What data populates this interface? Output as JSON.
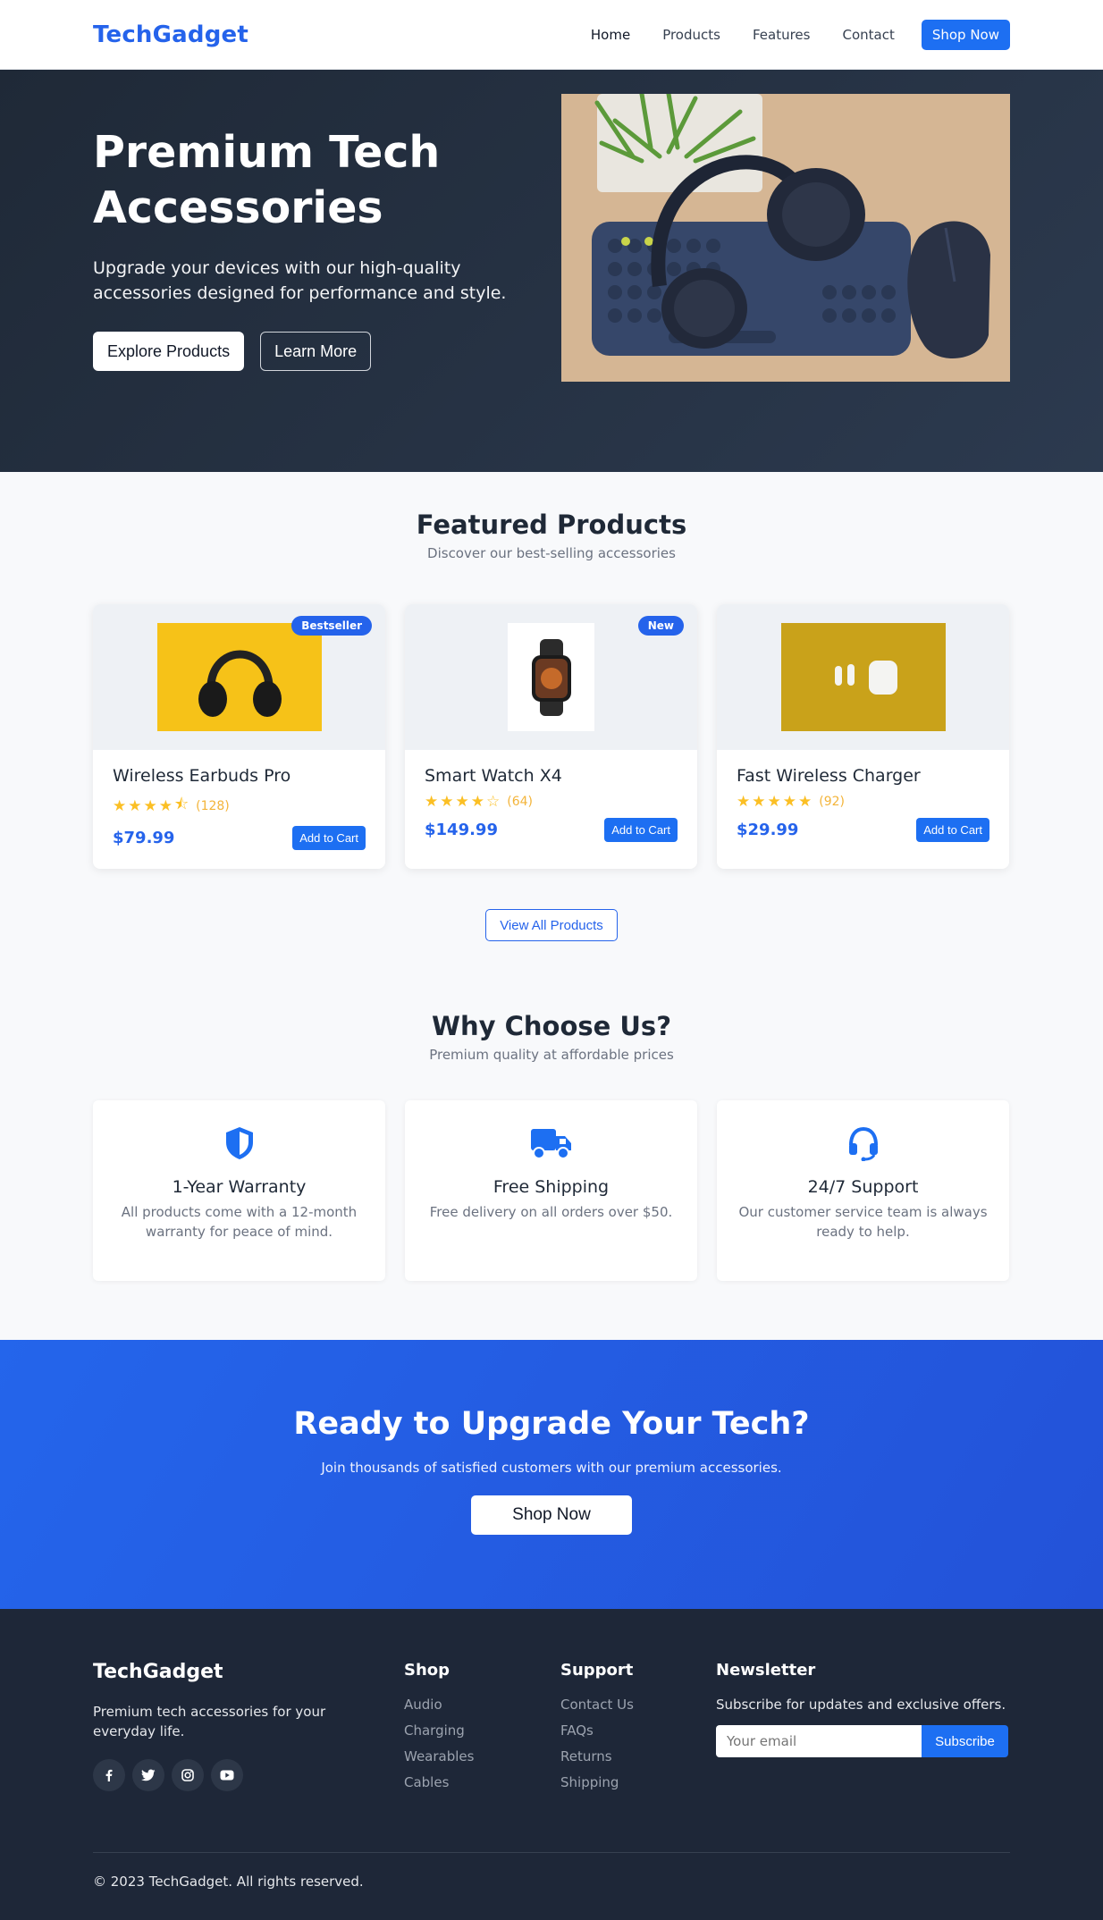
{
  "nav": {
    "brand": "TechGadget",
    "links": [
      "Home",
      "Products",
      "Features",
      "Contact"
    ],
    "cta": "Shop Now"
  },
  "hero": {
    "title": "Premium Tech Accessories",
    "subtitle": "Upgrade your devices with our high-quality accessories designed for performance and style.",
    "primary_button": "Explore Products",
    "secondary_button": "Learn More"
  },
  "featured": {
    "title": "Featured Products",
    "subtitle": "Discover our best-selling accessories",
    "view_all": "View All Products",
    "products": [
      {
        "name": "Wireless Earbuds Pro",
        "badge": "Bestseller",
        "rating": 4.5,
        "reviews": "(128)",
        "price": "$79.99",
        "button": "Add to Cart"
      },
      {
        "name": "Smart Watch X4",
        "badge": "New",
        "rating": 4,
        "reviews": "(64)",
        "price": "$149.99",
        "button": "Add to Cart"
      },
      {
        "name": "Fast Wireless Charger",
        "badge": "",
        "rating": 5,
        "reviews": "(92)",
        "price": "$29.99",
        "button": "Add to Cart"
      }
    ]
  },
  "why": {
    "title": "Why Choose Us?",
    "subtitle": "Premium quality at affordable prices",
    "features": [
      {
        "icon": "shield-icon",
        "title": "1-Year Warranty",
        "text": "All products come with a 12-month warranty for peace of mind."
      },
      {
        "icon": "truck-icon",
        "title": "Free Shipping",
        "text": "Free delivery on all orders over $50."
      },
      {
        "icon": "headset-icon",
        "title": "24/7 Support",
        "text": "Our customer service team is always ready to help."
      }
    ]
  },
  "cta": {
    "title": "Ready to Upgrade Your Tech?",
    "subtitle": "Join thousands of satisfied customers with our premium accessories.",
    "button": "Shop Now"
  },
  "footer": {
    "brand": "TechGadget",
    "description": "Premium tech accessories for your everyday life.",
    "socials": [
      "facebook-icon",
      "twitter-icon",
      "instagram-icon",
      "youtube-icon"
    ],
    "shop": {
      "title": "Shop",
      "links": [
        "Audio",
        "Charging",
        "Wearables",
        "Cables"
      ]
    },
    "support": {
      "title": "Support",
      "links": [
        "Contact Us",
        "FAQs",
        "Returns",
        "Shipping"
      ]
    },
    "newsletter": {
      "title": "Newsletter",
      "text": "Subscribe for updates and exclusive offers.",
      "placeholder": "Your email",
      "button": "Subscribe"
    },
    "copyright": "© 2023 TechGadget. All rights reserved."
  },
  "colors": {
    "accent": "#2563eb",
    "dark": "#1f2937",
    "footer": "#1e2738",
    "star": "#fbbf24"
  }
}
